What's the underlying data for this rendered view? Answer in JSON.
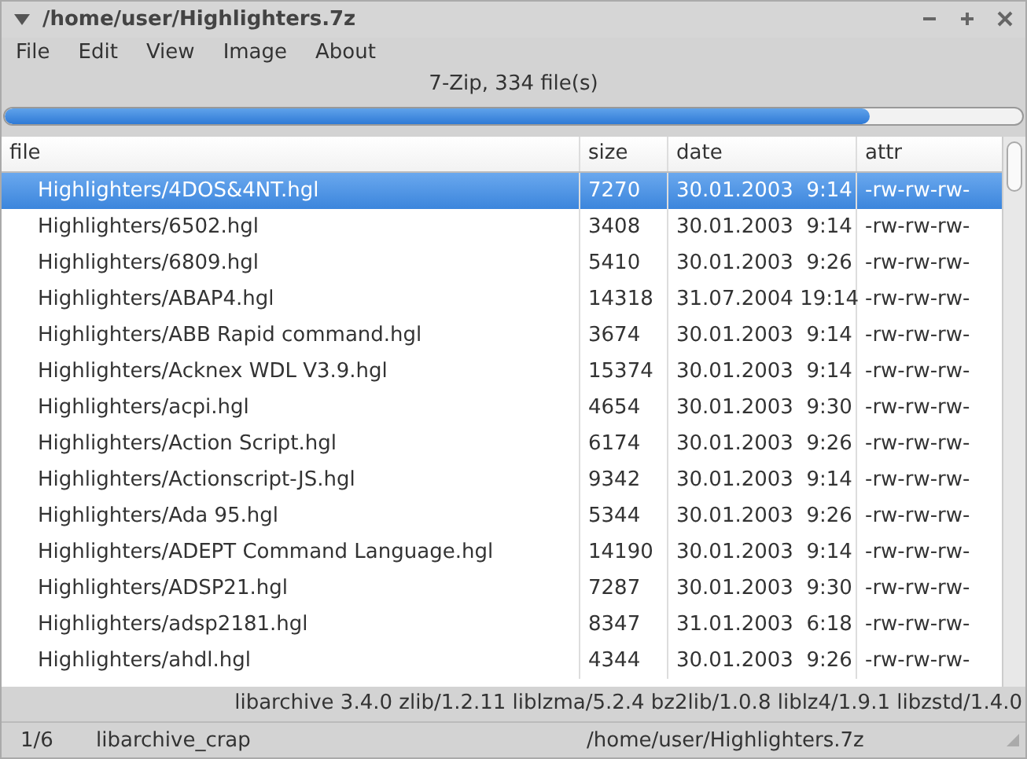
{
  "window": {
    "title": "/home/user/Highlighters.7z"
  },
  "menu": [
    "File",
    "Edit",
    "View",
    "Image",
    "About"
  ],
  "archive_info": "7-Zip, 334 file(s)",
  "progress": {
    "level": 0.85
  },
  "table": {
    "columns": [
      "file",
      "size",
      "date",
      "attr"
    ],
    "rows": [
      {
        "file": "Highlighters/4DOS&4NT.hgl",
        "size": "7270",
        "date": "30.01.2003  9:14",
        "attr": "-rw-rw-rw-",
        "selected": true
      },
      {
        "file": "Highlighters/6502.hgl",
        "size": "3408",
        "date": "30.01.2003  9:14",
        "attr": "-rw-rw-rw-",
        "selected": false
      },
      {
        "file": "Highlighters/6809.hgl",
        "size": "5410",
        "date": "30.01.2003  9:26",
        "attr": "-rw-rw-rw-",
        "selected": false
      },
      {
        "file": "Highlighters/ABAP4.hgl",
        "size": "14318",
        "date": "31.07.2004 19:14",
        "attr": "-rw-rw-rw-",
        "selected": false
      },
      {
        "file": "Highlighters/ABB Rapid command.hgl",
        "size": "3674",
        "date": "30.01.2003  9:14",
        "attr": "-rw-rw-rw-",
        "selected": false
      },
      {
        "file": "Highlighters/Acknex WDL V3.9.hgl",
        "size": "15374",
        "date": "30.01.2003  9:14",
        "attr": "-rw-rw-rw-",
        "selected": false
      },
      {
        "file": "Highlighters/acpi.hgl",
        "size": "4654",
        "date": "30.01.2003  9:30",
        "attr": "-rw-rw-rw-",
        "selected": false
      },
      {
        "file": "Highlighters/Action Script.hgl",
        "size": "6174",
        "date": "30.01.2003  9:26",
        "attr": "-rw-rw-rw-",
        "selected": false
      },
      {
        "file": "Highlighters/Actionscript-JS.hgl",
        "size": "9342",
        "date": "30.01.2003  9:14",
        "attr": "-rw-rw-rw-",
        "selected": false
      },
      {
        "file": "Highlighters/Ada 95.hgl",
        "size": "5344",
        "date": "30.01.2003  9:26",
        "attr": "-rw-rw-rw-",
        "selected": false
      },
      {
        "file": "Highlighters/ADEPT Command Language.hgl",
        "size": "14190",
        "date": "30.01.2003  9:14",
        "attr": "-rw-rw-rw-",
        "selected": false
      },
      {
        "file": "Highlighters/ADSP21.hgl",
        "size": "7287",
        "date": "30.01.2003  9:30",
        "attr": "-rw-rw-rw-",
        "selected": false
      },
      {
        "file": "Highlighters/adsp2181.hgl",
        "size": "8347",
        "date": "31.01.2003  6:18",
        "attr": "-rw-rw-rw-",
        "selected": false
      },
      {
        "file": "Highlighters/ahdl.hgl",
        "size": "4344",
        "date": "30.01.2003  9:26",
        "attr": "-rw-rw-rw-",
        "selected": false
      }
    ]
  },
  "library_info": "libarchive 3.4.0 zlib/1.2.11 liblzma/5.2.4 bz2lib/1.0.8 liblz4/1.9.1 libzstd/1.4.0",
  "status_bar": {
    "page": "1/6",
    "backend": "libarchive_crap",
    "path": "/home/user/Highlighters.7z"
  }
}
